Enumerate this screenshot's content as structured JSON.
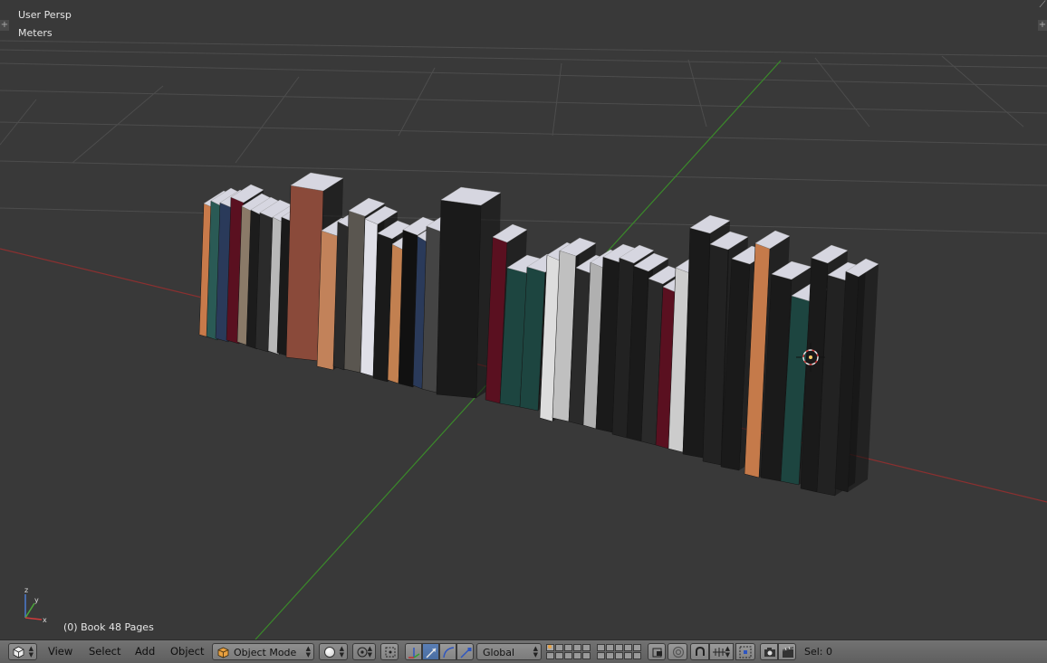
{
  "viewport": {
    "view_name": "User Persp",
    "units": "Meters",
    "selected_object": "(0) Book 48 Pages",
    "axis_labels": [
      "z",
      "y",
      "x"
    ]
  },
  "colors": {
    "background": "#393939",
    "grid": "#4d4d4d",
    "x_axis": "#8a3030",
    "y_axis": "#3a8a2a",
    "accent": "#5680c2"
  },
  "header": {
    "menus": [
      {
        "label": "View"
      },
      {
        "label": "Select"
      },
      {
        "label": "Add"
      },
      {
        "label": "Object"
      }
    ],
    "mode": "Object Mode",
    "orientation": "Global",
    "status": "Sel: 0",
    "icons": [
      "editor-type-icon",
      "viewport-shading-icon",
      "pivot-point-icon",
      "transform-manipulator-icon",
      "translate-icon",
      "rotate-icon",
      "scale-icon",
      "layers-icon",
      "lock-camera-icon",
      "proportional-edit-icon",
      "snap-icon",
      "snap-element-icon",
      "render-icon",
      "render-animation-icon"
    ]
  }
}
